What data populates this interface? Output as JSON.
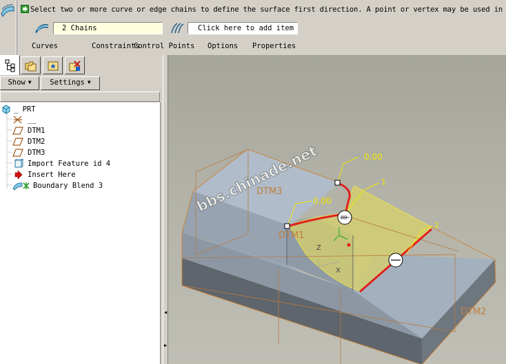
{
  "dashboard": {
    "message": "Select two or more curve or edge chains to define the surface first direction. A point or vertex may be used in pla",
    "first_direction_value": "2 Chains",
    "second_direction_value": "Click here to add item",
    "tabs": [
      "Curves",
      "Constraints",
      "Control Points",
      "Options",
      "Properties"
    ]
  },
  "left_panel": {
    "show_label": "Show",
    "settings_label": "Settings",
    "tree": {
      "root": "_ PRT",
      "items": [
        "__",
        "DTM1",
        "DTM2",
        "DTM3",
        "Import Feature id 4",
        "Insert Here",
        "Boundary Blend 3"
      ]
    }
  },
  "graphics": {
    "watermark": "bbs.chinade.net",
    "labels": {
      "dtm1": "DTM1",
      "dtm2": "DTM2",
      "dtm3": "DTM3",
      "value_top": "0.00",
      "value_left": "0.00",
      "chain_1": "1",
      "chain_2": "2",
      "axis_z": "Z",
      "axis_x": "X"
    },
    "colors": {
      "top_face": "#a8b4c2",
      "front_face": "#8c97a3",
      "bottom_face": "#5e656c",
      "chain_highlight": "#e02020",
      "dimension": "#f0e800",
      "datum": "#b87a40",
      "surface": "#d8d26a"
    }
  }
}
